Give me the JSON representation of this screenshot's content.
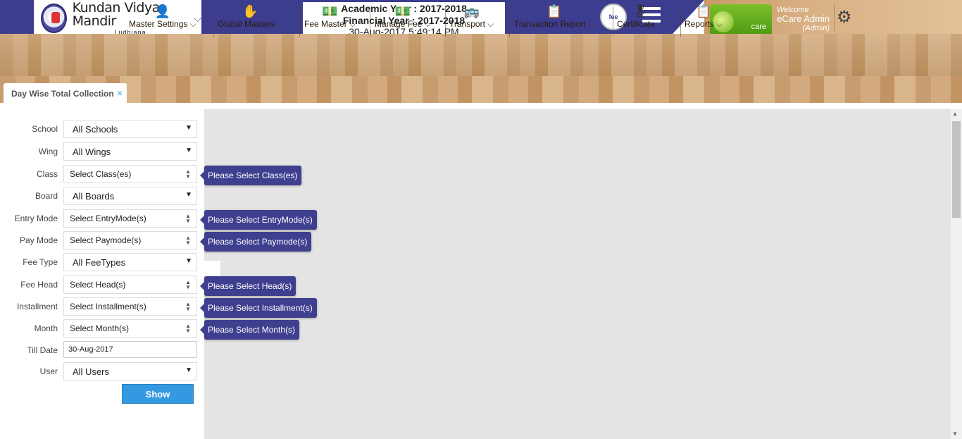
{
  "header": {
    "school_name": "Kundan Vidya Mandir",
    "school_city": "Ludhiana",
    "academic_year": "Academic Year : 2017-2018",
    "financial_year": "Financial Year : 2017-2018",
    "datetime": "30-Aug-2017 5:49:14 PM",
    "fee_logo_text": "fee",
    "ecare_logo_text": "care",
    "welcome": "Welcome",
    "user_name": "eCare Admin",
    "user_role": "(Admin)"
  },
  "nav": {
    "items": [
      {
        "label": "Master Settings",
        "icon": "user-edit-icon"
      },
      {
        "label": "Global Masters",
        "icon": "handshake-icon"
      },
      {
        "label": "Fee Master",
        "icon": "money-icon"
      },
      {
        "label": "Manage Fee",
        "icon": "money-icon"
      },
      {
        "label": "Transport",
        "icon": "bus-icon"
      },
      {
        "label": "Transaction Report",
        "icon": "report-icon"
      },
      {
        "label": "Certificate",
        "icon": "award-icon"
      },
      {
        "label": "Reports",
        "icon": "report-icon"
      }
    ]
  },
  "tab": {
    "label": "Day Wise Total Collection",
    "close": "×"
  },
  "form": {
    "school": {
      "label": "School",
      "value": "All Schools"
    },
    "wing": {
      "label": "Wing",
      "value": "All Wings"
    },
    "class": {
      "label": "Class",
      "value": "Select Class(es)",
      "tip": "Please Select Class(es)"
    },
    "board": {
      "label": "Board",
      "value": "All Boards"
    },
    "entry_mode": {
      "label": "Entry Mode",
      "value": "Select EntryMode(s)",
      "tip": "Please Select EntryMode(s)"
    },
    "pay_mode": {
      "label": "Pay Mode",
      "value": "Select Paymode(s)",
      "tip": "Please Select Paymode(s)"
    },
    "fee_type": {
      "label": "Fee Type",
      "value": "All FeeTypes"
    },
    "fee_head": {
      "label": "Fee Head",
      "value": "Select Head(s)",
      "tip": "Please Select Head(s)"
    },
    "installment": {
      "label": "Installment",
      "value": "Select Installment(s)",
      "tip": "Please Select Installment(s)"
    },
    "month": {
      "label": "Month",
      "value": "Select Month(s)",
      "tip": "Please Select Month(s)"
    },
    "till_date": {
      "label": "Till Date",
      "value": "30-Aug-2017"
    },
    "user": {
      "label": "User",
      "value": "All Users"
    },
    "show_label": "Show"
  },
  "colors": {
    "header_bg": "#3d3d8f",
    "tooltip_bg": "#3f3f8f",
    "button_bg": "#3399e0"
  }
}
